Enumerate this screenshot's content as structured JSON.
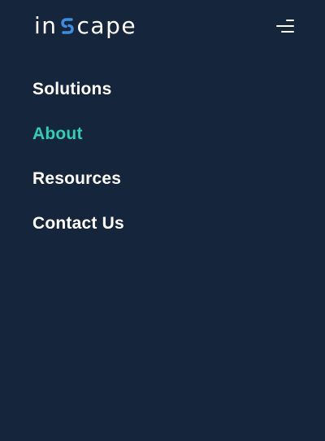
{
  "brand": {
    "name_prefix": "in",
    "name_suffix": "cape",
    "logo_mark_icon": "s-swirl-icon",
    "logo_mark_color": "#3b8fe0"
  },
  "menu_toggle": {
    "icon": "hamburger-menu-icon"
  },
  "nav": {
    "items": [
      {
        "label": "Solutions",
        "active": false
      },
      {
        "label": "About",
        "active": true
      },
      {
        "label": "Resources",
        "active": false
      },
      {
        "label": "Contact Us",
        "active": false
      }
    ]
  },
  "colors": {
    "background": "#15253c",
    "text": "#ffffff",
    "accent": "#2ecfb6"
  }
}
